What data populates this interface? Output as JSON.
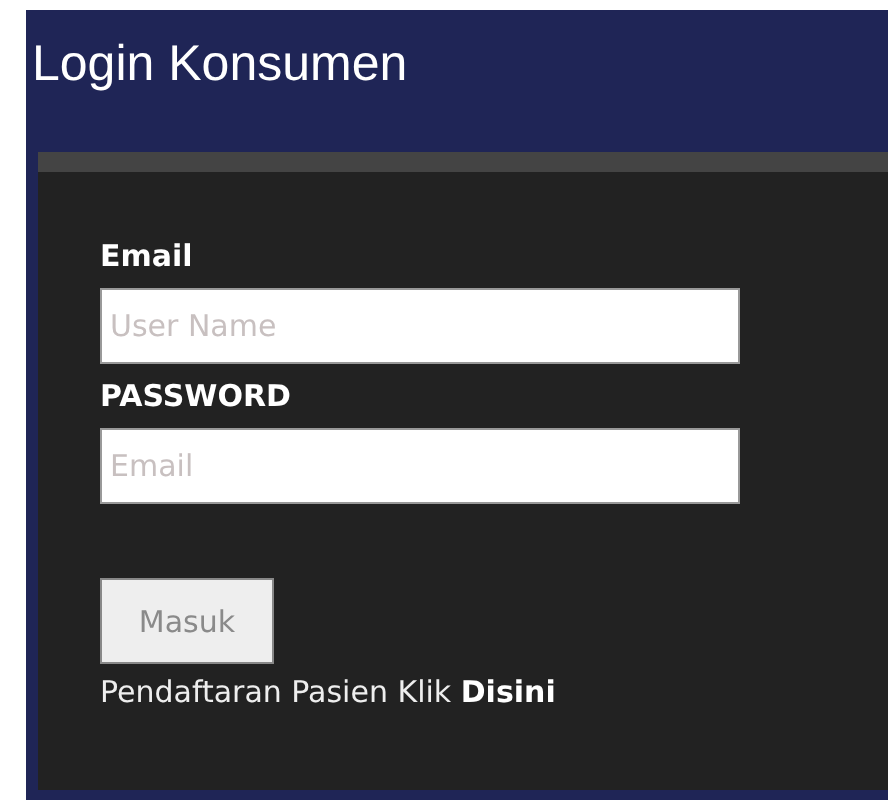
{
  "title": "Login Konsumen",
  "fields": [
    {
      "label": "Email",
      "placeholder": "User Name"
    },
    {
      "label": "PASSWORD",
      "placeholder": "Email"
    }
  ],
  "button": "Masuk",
  "register": {
    "text": "Pendaftaran Pasien Klik",
    "link": "Disini"
  }
}
